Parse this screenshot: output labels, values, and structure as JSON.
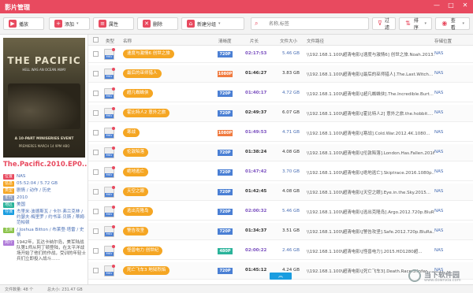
{
  "app": {
    "title": "影片管理"
  },
  "window_controls": {
    "minimize": "—",
    "maximize": "□",
    "close": "✕"
  },
  "toolbar": {
    "play_label": "播放",
    "add_label": "添加",
    "props_label": "属性",
    "delete_label": "删除",
    "new_group_label": "新建分组",
    "search_placeholder": "名称,标签",
    "filter_label": "过滤",
    "sort_label": "排序",
    "view_label": "查看",
    "caret": "▾"
  },
  "sidebar": {
    "poster_title": "THE PACIFIC",
    "poster_subtitle": "HELL WAS AN OCEAN AWAY",
    "poster_event": "A 10-PART MINISERIES EVENT",
    "poster_date": "PREMIERES MARCH 14 9PM HBO",
    "movie_name": "The.Pacific.2010.EP0...",
    "info": [
      {
        "tag": "位置",
        "tag_color": "#e84a5f",
        "value": "NAS"
      },
      {
        "tag": "信息",
        "tag_color": "#f5a623",
        "value": "05:52:04 / 5.72 GB"
      },
      {
        "tag": "类型",
        "tag_color": "#f5a623",
        "value": "剧情 / 动作 / 历史"
      },
      {
        "tag": "年代",
        "tag_color": "#8e9ec0",
        "value": "2010"
      },
      {
        "tag": "地区",
        "tag_color": "#2ab39a",
        "value": "美国"
      },
      {
        "tag": "导演",
        "tag_color": "#1a9de0",
        "value": "杰里米·波德斯瓦 / 卡尔·弗兰克林 / 约瑟夫·梅里罗 / 约书亚·贝斯 / 蒂姆·范帕顿"
      },
      {
        "tag": "主演",
        "tag_color": "#8bc34a",
        "value": "/ Joshua Bitton / 布莱登·塔雷 / 史蒂"
      },
      {
        "tag": "简介",
        "tag_color": "#b07bd9",
        "value": "1942年，瓦达卡纳尔岛，美军陆战队第1师从阿丁顿登陆，在太平洋战场开始了他们的作战，受训的年轻士兵们立即投入战斗……"
      }
    ]
  },
  "table": {
    "columns": {
      "type": "类型",
      "name": "名称",
      "resolution": "清晰度",
      "duration": "片长",
      "size": "文件大小",
      "path": "文件路径",
      "location": "存储位置"
    },
    "rows": [
      {
        "name": "速度与激情6 创世之旅",
        "res": "720P",
        "res_color": "#4a7fd4",
        "dur": "02:17:53",
        "dur_color": "#7a4fbf",
        "size": "5.46 GB",
        "size_color": "#4a6fb5",
        "path": "\\\\192.168.1.100\\超清电影\\[速度与激情6] 创世之旅.Noah.2013...",
        "loc": "NAS"
      },
      {
        "name": "最后的巫师猎人",
        "res": "1080P",
        "res_color": "#f07a3f",
        "dur": "01:46:27",
        "dur_color": "#333",
        "size": "3.83 GB",
        "size_color": "#333",
        "path": "\\\\192.168.1.100\\超清电影\\[最后的巫师猎人].The.Last.Witch...",
        "loc": "NAS"
      },
      {
        "name": "超凡蜘蛛侠",
        "res": "720P",
        "res_color": "#4a7fd4",
        "dur": "01:40:17",
        "dur_color": "#7a4fbf",
        "size": "4.72 GB",
        "size_color": "#4a6fb5",
        "path": "\\\\192.168.1.100\\超清电影\\[超凡蜘蛛侠].The.Incredible.Burt...",
        "loc": "NAS"
      },
      {
        "name": "霍比特人2 意外之旅",
        "res": "720P",
        "res_color": "#4a7fd4",
        "dur": "02:49:37",
        "dur_color": "#333",
        "size": "6.07 GB",
        "size_color": "#333",
        "path": "\\\\192.168.1.100\\超清电影\\[霍比特人2] 意外之旅.the.hobbit....",
        "loc": "NAS"
      },
      {
        "name": "寒战",
        "res": "1080P",
        "res_color": "#f07a3f",
        "dur": "01:49:53",
        "dur_color": "#7a4fbf",
        "size": "4.71 GB",
        "size_color": "#4a6fb5",
        "path": "\\\\192.168.1.100\\超清电影\\[寒战].Cold.War.2012.4K.1080...",
        "loc": "NAS"
      },
      {
        "name": "伦敦陷落",
        "res": "720P",
        "res_color": "#4a7fd4",
        "dur": "01:38:24",
        "dur_color": "#333",
        "size": "4.08 GB",
        "size_color": "#333",
        "path": "\\\\192.168.1.100\\超清电影\\[伦敦陷落].London.Has.Fallen.2016...",
        "loc": "NAS"
      },
      {
        "name": "绝地逃亡",
        "res": "720P",
        "res_color": "#4a7fd4",
        "dur": "01:47:42",
        "dur_color": "#7a4fbf",
        "size": "3.70 GB",
        "size_color": "#4a6fb5",
        "path": "\\\\192.168.1.100\\超清电影\\[绝地逃亡].Skiptrace.2016.1080p...",
        "loc": "NAS"
      },
      {
        "name": "天空之眼",
        "res": "720P",
        "res_color": "#4a7fd4",
        "dur": "01:42:45",
        "dur_color": "#333",
        "size": "4.08 GB",
        "size_color": "#333",
        "path": "\\\\192.168.1.100\\超清电影\\[天空之眼].Eye.in.the.Sky.2015...",
        "loc": "NAS"
      },
      {
        "name": "逃出克隆岛",
        "res": "720P",
        "res_color": "#4a7fd4",
        "dur": "02:00:32",
        "dur_color": "#7a4fbf",
        "size": "5.46 GB",
        "size_color": "#4a6fb5",
        "path": "\\\\192.168.1.100\\超清电影\\[逃出克隆岛].Argo.2012.720p.BluRa...",
        "loc": "NAS"
      },
      {
        "name": "警告攻坚",
        "res": "720P",
        "res_color": "#4a7fd4",
        "dur": "01:34:37",
        "dur_color": "#333",
        "size": "3.51 GB",
        "size_color": "#333",
        "path": "\\\\192.168.1.100\\超清电影\\[警告攻坚].Safe.2012.720p.BluRa...",
        "loc": "NAS"
      },
      {
        "name": "怪兽电力 创世纪",
        "res": "480P",
        "res_color": "#2ab39a",
        "dur": "02:00:22",
        "dur_color": "#7a4fbf",
        "size": "2.46 GB",
        "size_color": "#4a6fb5",
        "path": "\\\\192.168.1.100\\超清电影\\[怪兽电力].2015.HD1280超...",
        "loc": "NAS"
      },
      {
        "name": "死亡飞车3 地狱烈焰",
        "res": "720P",
        "res_color": "#4a7fd4",
        "dur": "01:45:12",
        "dur_color": "#333",
        "size": "4.24 GB",
        "size_color": "#333",
        "path": "\\\\192.168.1.100\\超清电影\\[死亡飞车3].Death.Race.3.Infer...",
        "loc": "NAS"
      }
    ]
  },
  "scroll_top_label": "︽",
  "status": {
    "count": "文件数量: 48 个",
    "total": "总大小: 231.47 GB"
  },
  "watermark": {
    "cn": "当下软件园",
    "en": "www.downxia.com"
  },
  "colors": {
    "accent": "#e84a5f",
    "pill": "#f5a623"
  },
  "icons": {
    "play": "play-icon",
    "add": "plus-icon",
    "props": "properties-icon",
    "delete": "delete-icon",
    "new_group": "new-group-icon",
    "search": "search-icon",
    "filter": "filter-icon",
    "sort": "sort-icon",
    "view": "eye-icon"
  }
}
